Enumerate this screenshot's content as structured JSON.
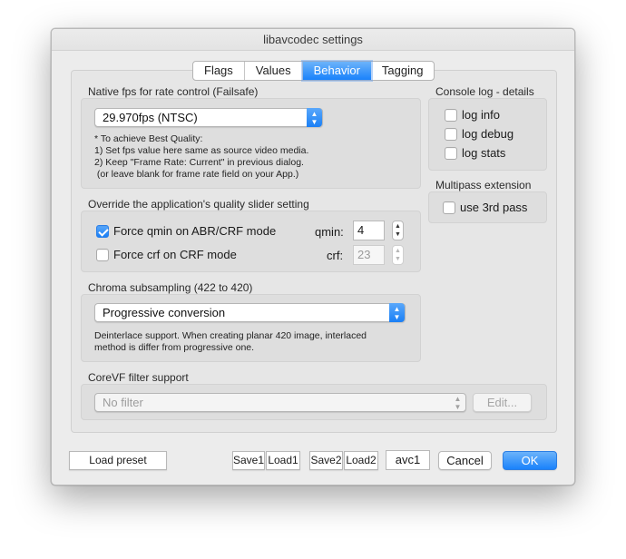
{
  "window": {
    "title": "libavcodec settings"
  },
  "tabs": [
    {
      "label": "Flags",
      "active": false
    },
    {
      "label": "Values",
      "active": false
    },
    {
      "label": "Behavior",
      "active": true
    },
    {
      "label": "Tagging",
      "active": false
    }
  ],
  "native_fps": {
    "label": "Native fps for rate control (Failsafe)",
    "selected": "29.970fps (NTSC)",
    "note": "* To achieve Best Quality:\n1) Set fps value here same as source video media.\n2) Keep \"Frame Rate: Current\" in previous dialog.\n (or leave blank for frame rate field on your App.)"
  },
  "console_log": {
    "label": "Console log - details",
    "items": [
      {
        "label": "log info",
        "checked": false
      },
      {
        "label": "log debug",
        "checked": false
      },
      {
        "label": "log stats",
        "checked": false
      }
    ]
  },
  "multipass": {
    "label": "Multipass extension",
    "use_3rd_pass": {
      "label": "use 3rd pass",
      "checked": false
    }
  },
  "override": {
    "label": "Override the application's quality slider setting",
    "force_qmin": {
      "label": "Force qmin on ABR/CRF mode",
      "checked": true
    },
    "qmin_label": "qmin:",
    "qmin_value": "4",
    "force_crf": {
      "label": "Force crf on CRF mode",
      "checked": false
    },
    "crf_label": "crf:",
    "crf_value": "23"
  },
  "chroma": {
    "label": "Chroma subsampling (422 to 420)",
    "selected": "Progressive conversion",
    "note": "Deinterlace support. When creating planar 420 image, interlaced\nmethod is differ from progressive one."
  },
  "corevf": {
    "label": "CoreVF filter support",
    "selected": "No filter",
    "edit_label": "Edit..."
  },
  "footer": {
    "load_preset": "Load preset",
    "save1": "Save1",
    "load1": "Load1",
    "save2": "Save2",
    "load2": "Load2",
    "preset_name": "avc1",
    "cancel": "Cancel",
    "ok": "OK"
  },
  "colors": {
    "accent": "#1a82fb",
    "window_bg": "#ececec"
  },
  "icons": {
    "popup_arrows": "up-down-chevron-icon",
    "stepper": "stepper-arrows-icon",
    "checkmark": "checkmark-icon"
  }
}
